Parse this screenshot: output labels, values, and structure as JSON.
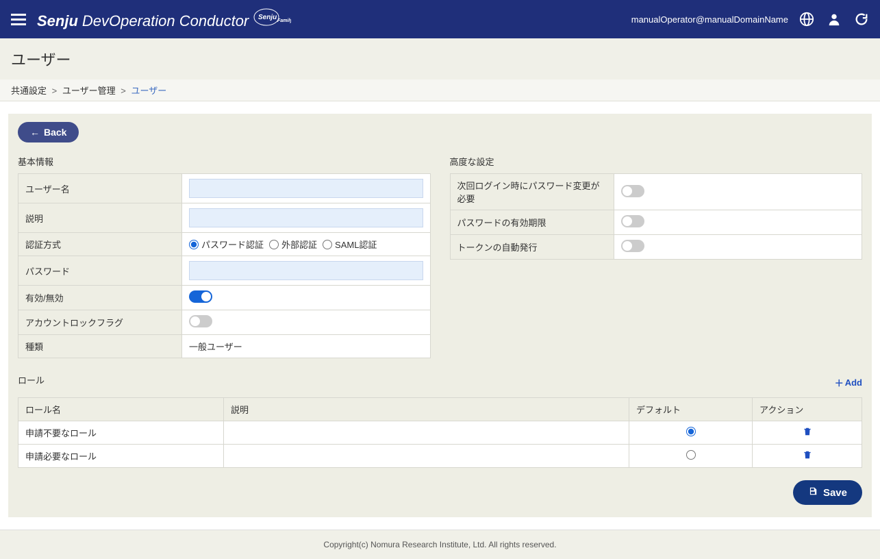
{
  "header": {
    "brand_main": "Senju",
    "brand_sub": "DevOperation Conductor",
    "brand_tag": "Senju",
    "brand_family": "Family",
    "user": "manualOperator@manualDomainName"
  },
  "page": {
    "title": "ユーザー"
  },
  "breadcrumb": {
    "item1": "共通設定",
    "item2": "ユーザー管理",
    "current": "ユーザー",
    "sep": ">"
  },
  "buttons": {
    "back": "Back",
    "save": "Save",
    "add": "Add"
  },
  "basic": {
    "section": "基本情報",
    "username_label": "ユーザー名",
    "username_value": "",
    "description_label": "説明",
    "description_value": "",
    "auth_label": "認証方式",
    "auth_options": {
      "password": "パスワード認証",
      "external": "外部認証",
      "saml": "SAML認証"
    },
    "auth_selected": "password",
    "password_label": "パスワード",
    "password_value": "",
    "enabled_label": "有効/無効",
    "enabled_value": true,
    "lock_label": "アカウントロックフラグ",
    "lock_value": false,
    "kind_label": "種類",
    "kind_value": "一般ユーザー"
  },
  "advanced": {
    "section": "高度な設定",
    "next_login_pw_label": "次回ログイン時にパスワード変更が必要",
    "next_login_pw_value": false,
    "pw_expiry_label": "パスワードの有効期限",
    "pw_expiry_value": false,
    "token_auto_label": "トークンの自動発行",
    "token_auto_value": false
  },
  "roles": {
    "section": "ロール",
    "col_name": "ロール名",
    "col_desc": "説明",
    "col_default": "デフォルト",
    "col_action": "アクション",
    "rows": [
      {
        "name": "申請不要なロール",
        "desc": "",
        "default": true
      },
      {
        "name": "申請必要なロール",
        "desc": "",
        "default": false
      }
    ]
  },
  "footer": {
    "copyright": "Copyright(c) Nomura Research Institute, Ltd. All rights reserved."
  }
}
